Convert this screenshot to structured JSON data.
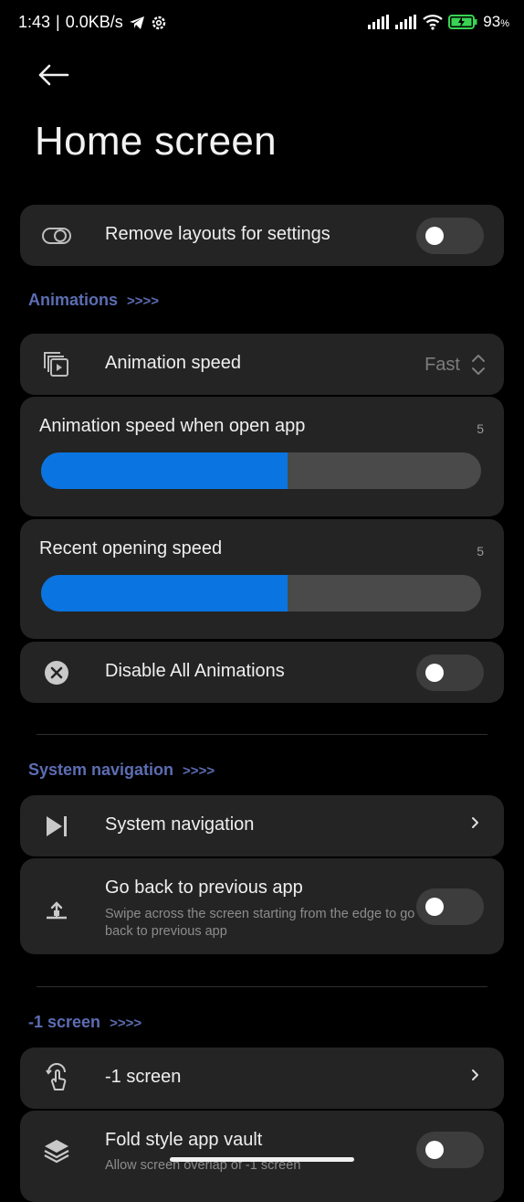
{
  "status_bar": {
    "time": "1:43",
    "network_speed": "0.0KB/s",
    "battery": "93",
    "battery_unit": "%"
  },
  "header": {
    "back_icon": "arrow-left-icon",
    "title": "Home screen"
  },
  "layouts_row": {
    "label": "Remove layouts for settings",
    "icon": "toggle-outline-icon",
    "enabled": false
  },
  "sections": {
    "animations": {
      "title": "Animations",
      "arrows": ">>>>"
    },
    "system_navigation": {
      "title": "System navigation",
      "arrows": ">>>>"
    },
    "minus_one_screen": {
      "title": "-1 screen",
      "arrows": ">>>>"
    }
  },
  "animation_speed": {
    "label": "Animation speed",
    "value": "Fast",
    "icon": "layered-play-icon"
  },
  "open_app_speed": {
    "label": "Animation speed when open app",
    "value": "5",
    "fraction": 0.56
  },
  "recent_speed": {
    "label": "Recent opening speed",
    "value": "5",
    "fraction": 0.56
  },
  "disable_animations": {
    "label": "Disable All Animations",
    "icon": "close-circle-icon",
    "enabled": false
  },
  "system_navigation_row": {
    "label": "System navigation",
    "icon": "navigation-play-icon"
  },
  "go_back_row": {
    "label": "Go back to previous app",
    "subtitle": "Swipe across the screen starting from the edge to go back to previous app",
    "icon": "swipe-gesture-icon",
    "enabled": false
  },
  "minus_one_row": {
    "label": "-1 screen",
    "icon": "touch-gesture-icon"
  },
  "fold_vault_row": {
    "label": "Fold style app vault",
    "subtitle": "Allow screen overlap of -1 screen",
    "icon": "layers-icon",
    "enabled": false
  },
  "colors": {
    "accent": "#0a74e0",
    "section_title": "#5c6db3",
    "card": "#242424"
  }
}
